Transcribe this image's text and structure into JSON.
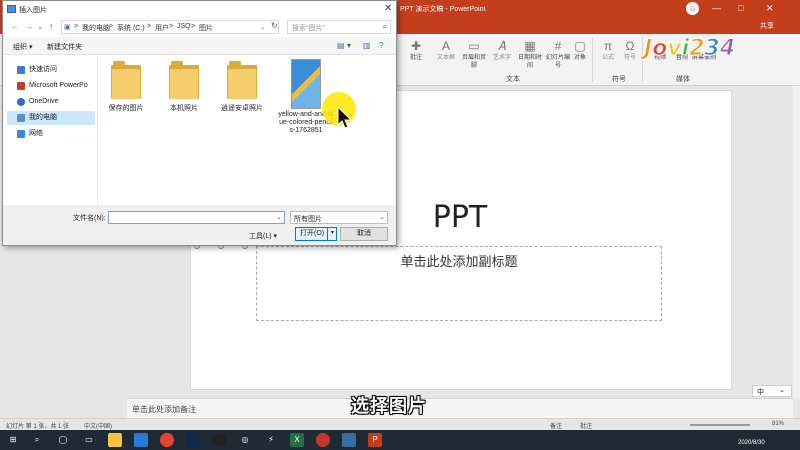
{
  "ppt": {
    "window_title": "PPT 演示文稿 - PowerPoint",
    "avatar": "☺",
    "minimize": "—",
    "restore": "□",
    "close": "✕",
    "share": "共享",
    "ribbon": {
      "buttons": [
        {
          "label": "批注"
        },
        {
          "label": "文本框"
        },
        {
          "label": "页眉和页脚"
        },
        {
          "label": "艺术字"
        },
        {
          "label": "日期和时间"
        },
        {
          "label": "幻灯片编号"
        },
        {
          "label": "对象"
        },
        {
          "label": "公式"
        },
        {
          "label": "符号"
        },
        {
          "label": "视频"
        },
        {
          "label": "音频"
        },
        {
          "label": "屏幕录制"
        }
      ],
      "groups": {
        "text": "文本",
        "symbols": "符号",
        "media": "媒体"
      }
    },
    "watermark_logo": "Jovi234",
    "slide": {
      "title": "PPT",
      "subtitle": "单击此处添加副标题"
    },
    "notes_placeholder": "单击此处添加备注",
    "status": {
      "slide_counter": "幻灯片 第 1 张，共 1 张",
      "language": "中文(中国)",
      "notes": "备注",
      "comments": "批注",
      "zoom": "81%"
    },
    "ime": {
      "mode": "中",
      "more": "⌄"
    }
  },
  "caption": "选择图片",
  "dialog": {
    "title": "插入图片",
    "close": "✕",
    "nav": {
      "back": "←",
      "forward": "→",
      "dropdown": "⌄",
      "up": "↑"
    },
    "breadcrumb": [
      "我的电脑",
      "系统 (C:)",
      "用户",
      "JSQ",
      "图片"
    ],
    "breadcrumb_sep": ">",
    "search_placeholder": "搜索\"图片\"",
    "toolbar": {
      "organize": "组织 ▾",
      "new_folder": "新建文件夹"
    },
    "sidebar": [
      {
        "label": "快速访问",
        "color": "#3a7ad6"
      },
      {
        "label": "Microsoft PowerPo",
        "color": "#c43e1c"
      },
      {
        "label": "OneDrive",
        "color": "#2b6fd1"
      },
      {
        "label": "我的电脑",
        "color": "#5a8fcf",
        "selected": true
      },
      {
        "label": "网络",
        "color": "#3a88d8"
      }
    ],
    "files": [
      {
        "label": "保存的图片",
        "type": "folder"
      },
      {
        "label": "本机照片",
        "type": "folder"
      },
      {
        "label": "逍遥安卓照片",
        "type": "folder"
      },
      {
        "label": "yellow-and-and-blue-colored-pencils-1762851",
        "type": "image"
      }
    ],
    "filename_label": "文件名(N):",
    "filename_value": "",
    "filter_value": "所有图片",
    "tools_label": "工具(L)  ▾",
    "open_label": "打开(O)",
    "open_dd": "▾",
    "cancel_label": "取消"
  },
  "taskbar": {
    "time": "",
    "date": "2020/8/30"
  }
}
